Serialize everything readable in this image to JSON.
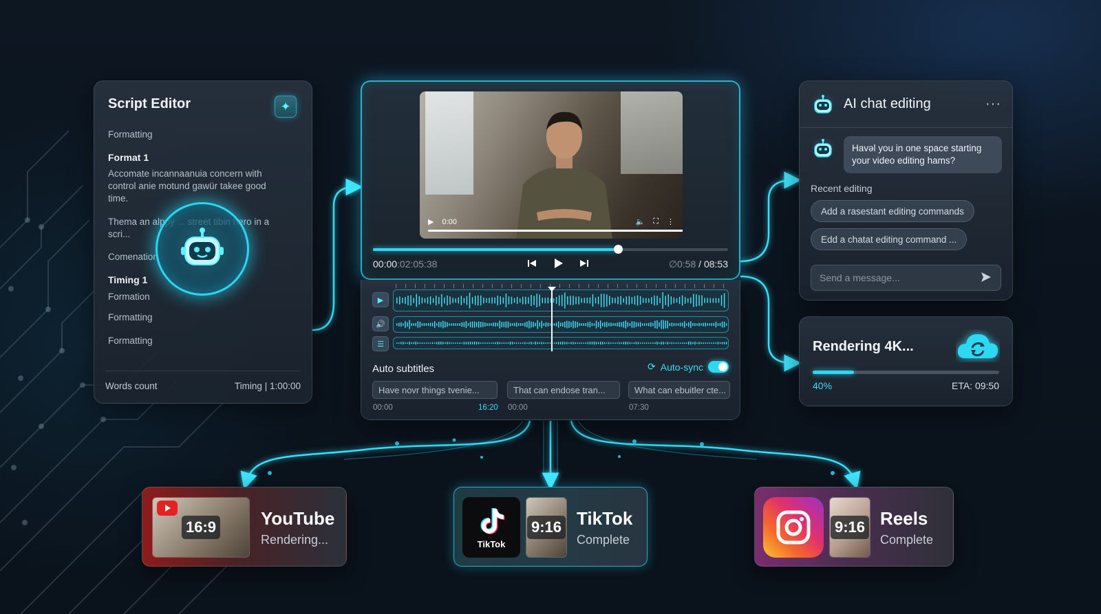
{
  "script_editor": {
    "title": "Script Editor",
    "formatting_1": "Formatting",
    "format_heading": "Format 1",
    "paragraph": "Accomate incannaanuia concern with control anie motund gawür takee good time.",
    "paragraph2": "Thema an alppy ... street tibin hero in a scri...",
    "comenation": "Comenation",
    "timing_heading": "Timing 1",
    "formation": "Formation",
    "formatting_2": "Formatting",
    "formatting_3": "Formatting",
    "words_count_label": "Words count",
    "timing_label": "Timing",
    "timing_value": "1:00:00"
  },
  "video": {
    "overlay_time": "0:00",
    "current_time": "00:00",
    "current_time_dim": ":02:05:38",
    "remaining_dim": "∅0:58",
    "total": " / 08:53",
    "progress": 0.69,
    "inner_progress": 0.06
  },
  "timeline": {
    "subtitles_label": "Auto subtitles",
    "autosync_label": "Auto-sync",
    "autosync_on": true,
    "subtitles": [
      {
        "text": "Have novr things tvenie...",
        "start": "00:00",
        "end": "16:20"
      },
      {
        "text": "That can endose tran...",
        "start": "00:00",
        "end": ""
      },
      {
        "text": "What can ebuitler cte...",
        "start": "07:30",
        "end": ""
      }
    ]
  },
  "chat": {
    "title": "AI chat editing",
    "message": "Havǝl you in one space starting your video editing hams?",
    "recent_label": "Recent editing",
    "commands": [
      "Add a rasestant editing commands",
      "Edd a chatat editing command ..."
    ],
    "input_placeholder": "Send a message..."
  },
  "render": {
    "title": "Rendering 4K...",
    "progress": 0.22,
    "percent_label": "40%",
    "eta": "ETA: 09:50"
  },
  "outputs": {
    "youtube": {
      "name": "YouTube",
      "status": "Rendering...",
      "ratio": "16:9"
    },
    "tiktok": {
      "name": "TikTok",
      "status": "Complete",
      "ratio": "9:16",
      "logo_text": "TikTok"
    },
    "reels": {
      "name": "Reels",
      "status": "Complete",
      "ratio": "9:16"
    }
  },
  "colors": {
    "accent": "#2fd8f2",
    "youtube": "#e52222",
    "background": "#0b141e"
  }
}
